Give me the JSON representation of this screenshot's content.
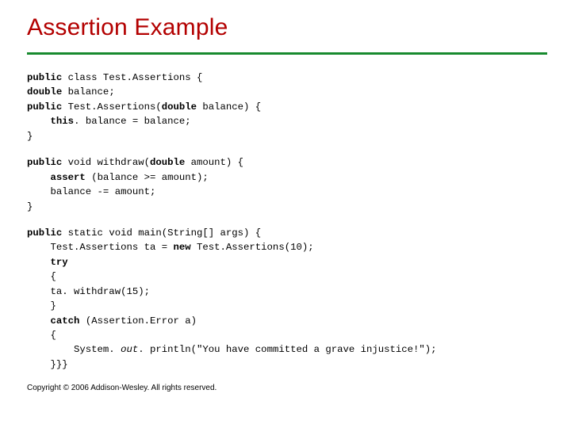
{
  "title": "Assertion Example",
  "code": {
    "b1": {
      "l1a": "public",
      "l1b": " class Test.Assertions {",
      "l2a": "double",
      "l2b": " balance;",
      "l3a": "public",
      "l3b": " Test.Assertions(",
      "l3c": "double",
      "l3d": " balance) {",
      "l4a": "    ",
      "l4b": "this",
      "l4c": ". balance = balance;",
      "l5": "}"
    },
    "b2": {
      "l1a": "public",
      "l1b": " void withdraw(",
      "l1c": "double",
      "l1d": " amount) {",
      "l2a": "    ",
      "l2b": "assert",
      "l2c": " (balance >= amount);",
      "l3": "    balance -= amount;",
      "l4": "}"
    },
    "b3": {
      "l1a": "public",
      "l1b": " static void main(String[] args) {",
      "l2a": "    Test.Assertions ta = ",
      "l2b": "new",
      "l2c": " Test.Assertions(10);",
      "l3a": "    ",
      "l3b": "try",
      "l4": "    {",
      "l5": "    ta. withdraw(15);",
      "l6": "    }",
      "l7a": "    ",
      "l7b": "catch",
      "l7c": " (Assertion.Error a)",
      "l8": "    {",
      "l9a": "        System. ",
      "l9b": "out",
      "l9c": ". println(\"You have committed a grave injustice!\");",
      "l10": "    }}}"
    }
  },
  "copyright": "Copyright © 2006 Addison-Wesley. All rights reserved."
}
